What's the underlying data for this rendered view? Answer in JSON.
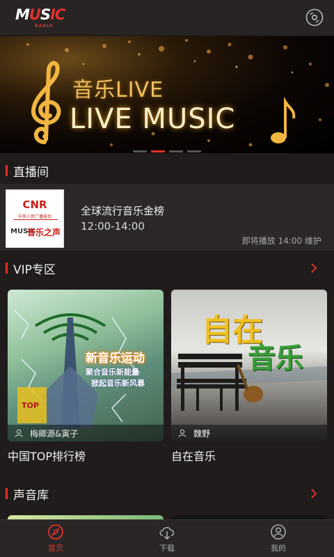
{
  "header": {
    "logo_text_main": "MUSIC",
    "logo_text_sub": "RADIO",
    "disc_icon": "disc-icon"
  },
  "banner": {
    "line1": "音乐LIVE",
    "line2": "LIVE MUSIC",
    "pager_active_index": 1,
    "pager_count": 4
  },
  "sections": {
    "live": "直播间",
    "vip": "VIP专区",
    "library": "声音库"
  },
  "live_card": {
    "thumb_brand": "CNR",
    "thumb_sub": "中央人民广播电台",
    "thumb_brand_bottom": "MUSIC",
    "thumb_brand_bottom_cn": "音乐之声",
    "program_name": "全球流行音乐金榜",
    "time_range": "12:00-14:00",
    "status": "即将播放 14:00 维护"
  },
  "vip_cards": [
    {
      "poster_title": "新音乐运动",
      "poster_line1": "聚合音乐新能量",
      "poster_line2": "掀起音乐新风暴",
      "poster_badge": "TOP",
      "author": "梅卿源&寅子",
      "caption": "中国TOP排行榜"
    },
    {
      "poster_title_1": "自在",
      "poster_title_2": "音乐",
      "author": "魏野",
      "caption": "自在音乐"
    }
  ],
  "tabbar": {
    "items": [
      {
        "label": "首页",
        "icon": "compass-icon",
        "active": true
      },
      {
        "label": "下载",
        "icon": "cloud-download-icon",
        "active": false
      },
      {
        "label": "我的",
        "icon": "user-icon",
        "active": false
      }
    ]
  },
  "colors": {
    "accent": "#e0312b",
    "background": "#201c1c",
    "header": "#282424"
  }
}
